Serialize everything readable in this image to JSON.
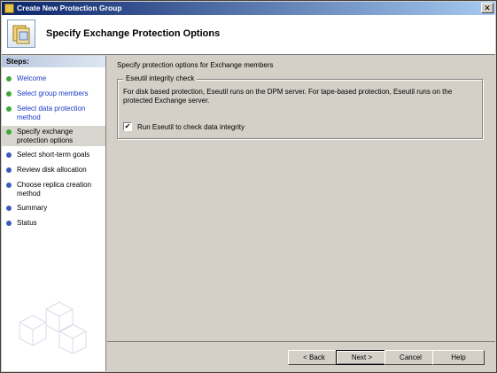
{
  "window": {
    "title": "Create New Protection Group",
    "close_label": "✕"
  },
  "header": {
    "title": "Specify Exchange Protection Options"
  },
  "sidebar": {
    "heading": "Steps:",
    "items": [
      {
        "label": "Welcome",
        "state": "done"
      },
      {
        "label": "Select group members",
        "state": "done"
      },
      {
        "label": "Select data protection method",
        "state": "done"
      },
      {
        "label": "Specify exchange protection options",
        "state": "current"
      },
      {
        "label": "Select short-term goals",
        "state": "pending"
      },
      {
        "label": "Review disk allocation",
        "state": "pending"
      },
      {
        "label": "Choose replica creation method",
        "state": "pending"
      },
      {
        "label": "Summary",
        "state": "pending"
      },
      {
        "label": "Status",
        "state": "pending"
      }
    ]
  },
  "content": {
    "intro": "Specify protection options for Exchange members",
    "group": {
      "legend": "Eseutil integrity check",
      "description": "For disk based protection, Eseutil runs on the DPM server. For tape-based protection, Eseutil runs on the protected Exchange server.",
      "checkbox_label": "Run Eseutil to check data integrity",
      "checkbox_checked": true,
      "check_mark": "✔"
    }
  },
  "buttons": {
    "back": "< Back",
    "next": "Next >",
    "cancel": "Cancel",
    "help": "Help"
  }
}
